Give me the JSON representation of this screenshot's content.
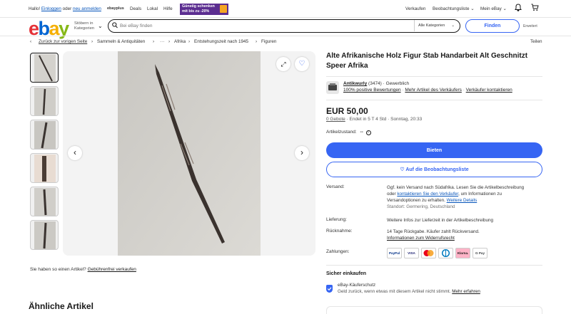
{
  "topbar": {
    "greeting": "Hallo!",
    "login": "Einloggen",
    "or": "oder",
    "register": "neu anmelden",
    "ebayplus": "ebayplus",
    "deals": "Deals",
    "local": "Lokal",
    "help": "Hilfe",
    "promo_line1": "Günstig schenken",
    "promo_line2": "mit bis zu -20%",
    "sell": "Verkaufen",
    "watchlist": "Beobachtungsliste",
    "myebay": "Mein eBay"
  },
  "header": {
    "shop_by_1": "Stöbern in",
    "shop_by_2": "Kategorien",
    "search_placeholder": "Bei eBay finden",
    "category_select": "Alle Kategorien",
    "search_button": "Finden",
    "advanced": "Erweitert"
  },
  "breadcrumb": {
    "back": "Zurück zur vorigen Seite",
    "items": [
      "Sammeln & Antiquitäten",
      "···",
      "Afrika",
      "Entstehungszeit nach 1945",
      "Figuren"
    ],
    "share": "Teilen"
  },
  "gallery": {
    "thumb_count": 6,
    "sell_question": "Sie haben so einen Artikel?",
    "sell_link": "Gebührenfrei verkaufen"
  },
  "similar": {
    "heading": "Ähnliche Artikel"
  },
  "item": {
    "title": "Alte Afrikanische Holz Figur Stab Handarbeit Alt Geschnitzt Speer Afrika",
    "seller_name": "Antikwurly",
    "seller_feedback": "(3474)",
    "seller_type": "· Gewerblich",
    "seller_positive": "100% positive Bewertungen",
    "seller_more": "Mehr Artikel des Verkäufers",
    "seller_contact": "Verkäufer kontaktieren",
    "price": "EUR 50,00",
    "bids": "0 Gebote",
    "ends": "· Endet in 5 T 4 Std · Sonntag, 20:33",
    "condition_label": "Artikelzustand:",
    "condition_value": "--",
    "bid_button": "Bieten",
    "watch_button": "♡ Auf die Beobachtungsliste"
  },
  "details": {
    "shipping_label": "Versand:",
    "shipping_text_1": "Ggf. kein Versand nach Südafrika. Lesen Sie die Artikelbeschreibung",
    "shipping_text_2a": "oder",
    "shipping_text_2_link": "kontaktieren Sie den Verkäufer",
    "shipping_text_2b": ", um Informationen zu",
    "shipping_text_3": "Versandoptionen zu erhalten.",
    "shipping_text_3_link": "Weitere Details",
    "location": "Standort: Germering, Deutschland",
    "delivery_label": "Lieferung:",
    "delivery_text": "Weitere Infos zur Lieferzeit in der Artikelbeschreibung",
    "returns_label": "Rücknahme:",
    "returns_text": "14 Tage Rückgabe. Käufer zahlt Rückversand.",
    "returns_link": "Informationen zum Widerrufsrecht",
    "payments_label": "Zahlungen:",
    "payments": [
      "PayPal",
      "VISA",
      "MC",
      "DC",
      "Klarna.",
      "G Pay"
    ]
  },
  "buy_safe": {
    "heading": "Sicher einkaufen",
    "protection_title": "eBay-Käuferschutz",
    "protection_text": "Geld zurück, wenn etwas mit diesem Artikel nicht stimmt.",
    "protection_link": "Mehr erfahren"
  },
  "colors": {
    "accent": "#3665f3",
    "link": "#0654ba",
    "promo": "#5b2d90"
  }
}
